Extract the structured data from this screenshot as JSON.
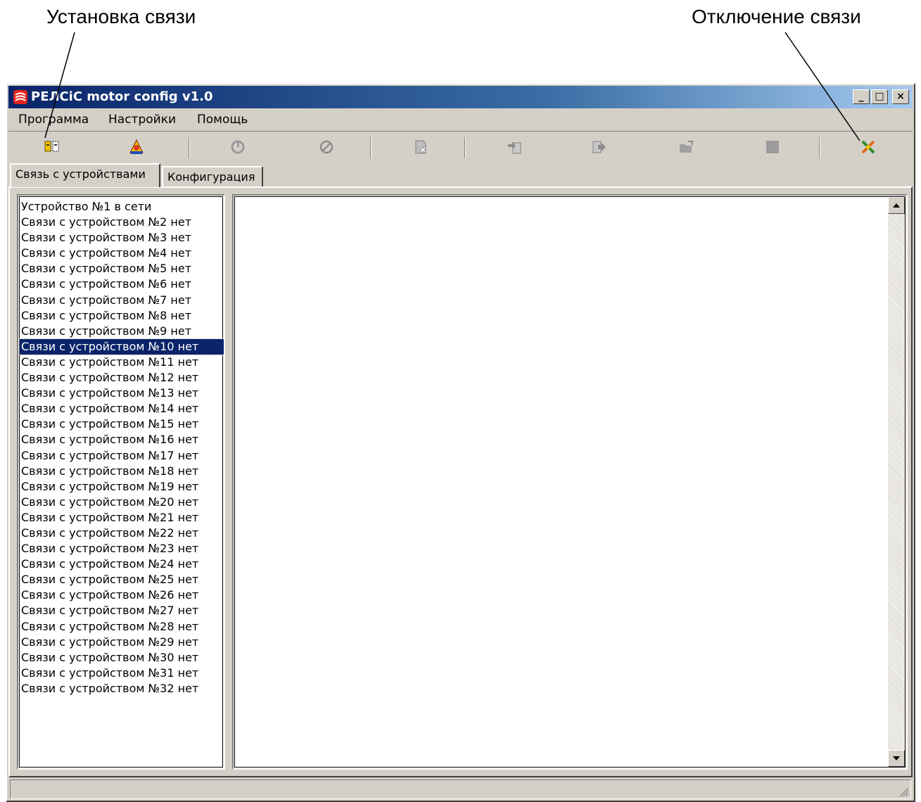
{
  "annotations": {
    "left": "Установка связи",
    "right": "Отключение связи"
  },
  "window": {
    "title": "РЕЛСіС motor config v1.0",
    "controls": [
      "minimize",
      "maximize",
      "close"
    ]
  },
  "menu": {
    "items": [
      "Программа",
      "Настройки",
      "Помощь"
    ]
  },
  "toolbar": {
    "icons": [
      "connect-icon",
      "search-devices-icon",
      "refresh-icon",
      "cancel-icon",
      "delete-file-icon",
      "import-icon",
      "export-icon",
      "open-folder-icon",
      "stop-icon",
      "disconnect-icon"
    ]
  },
  "tabs": [
    {
      "label": "Связь с устройствами",
      "active": true
    },
    {
      "label": "Конфигурация",
      "active": false
    }
  ],
  "device_list": {
    "items": [
      "Устройство №1 в сети",
      "Связи с устройством №2 нет",
      "Связи с устройством №3 нет",
      "Связи с устройством №4 нет",
      "Связи с устройством №5 нет",
      "Связи с устройством №6 нет",
      "Связи с устройством №7 нет",
      "Связи с устройством №8 нет",
      "Связи с устройством №9 нет",
      "Связи с устройством №10 нет",
      "Связи с устройством №11 нет",
      "Связи с устройством №12 нет",
      "Связи с устройством №13 нет",
      "Связи с устройством №14 нет",
      "Связи с устройством №15 нет",
      "Связи с устройством №16 нет",
      "Связи с устройством №17 нет",
      "Связи с устройством №18 нет",
      "Связи с устройством №19 нет",
      "Связи с устройством №20 нет",
      "Связи с устройством №21 нет",
      "Связи с устройством №22 нет",
      "Связи с устройством №23 нет",
      "Связи с устройством №24 нет",
      "Связи с устройством №25 нет",
      "Связи с устройством №26 нет",
      "Связи с устройством №27 нет",
      "Связи с устройством №28 нет",
      "Связи с устройством №29 нет",
      "Связи с устройством №30 нет",
      "Связи с устройством №31 нет",
      "Связи с устройством №32 нет"
    ],
    "selected_index": 9
  },
  "colors": {
    "window_bg": "#d4d0c8",
    "title_start": "#0a246a",
    "title_end": "#a6caf0",
    "selection": "#0a246a"
  }
}
